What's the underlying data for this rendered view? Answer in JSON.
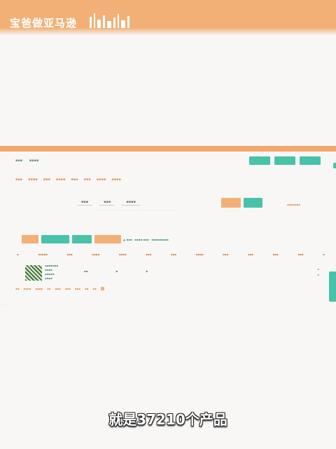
{
  "banner": {
    "brand": "宝爸做亚马逊"
  },
  "subtitle": "就是37210个产品",
  "colors": {
    "accent_orange": "#f2b077",
    "accent_teal": "#48c3aa",
    "background": "#f8f7f5"
  }
}
